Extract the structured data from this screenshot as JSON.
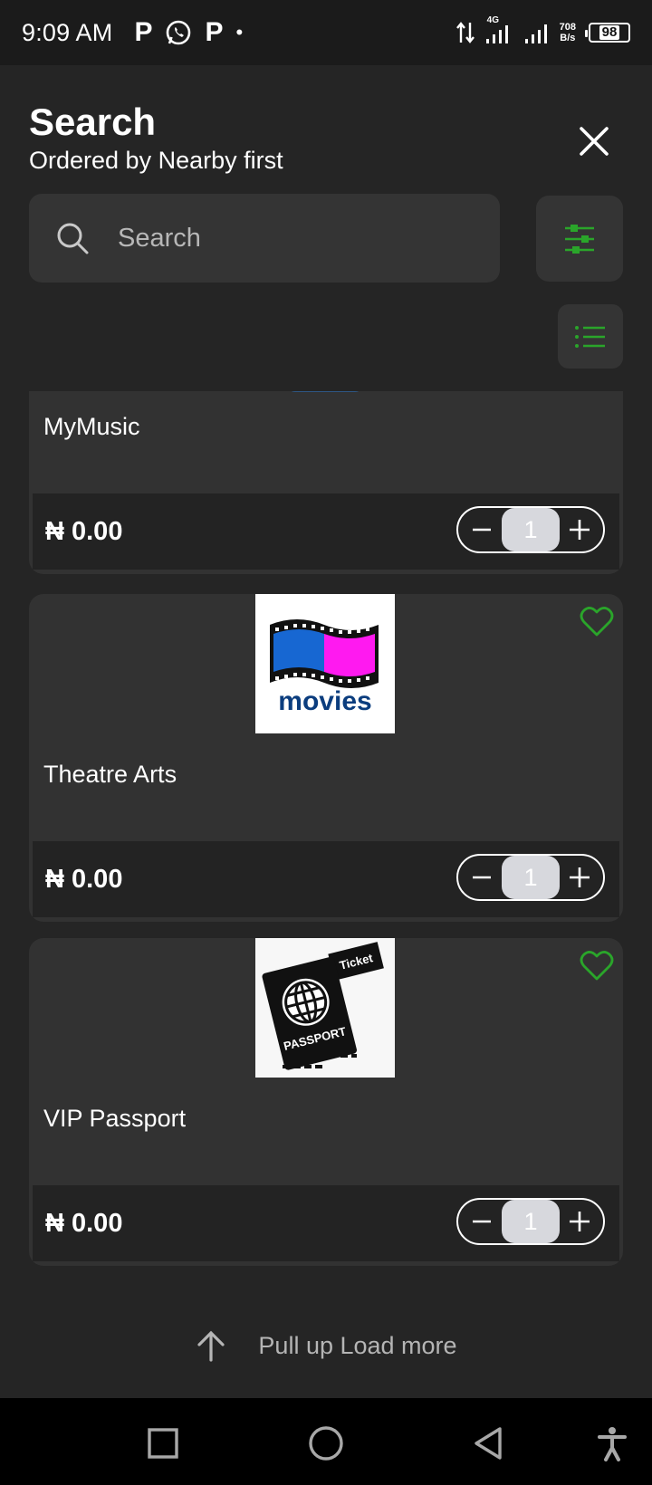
{
  "status_bar": {
    "time": "9:09 AM",
    "notif_p1": "P",
    "notif_p2": "P",
    "notif_dot": "•",
    "network_type": "4G",
    "net_speed_value": "708",
    "net_speed_unit": "B/s",
    "battery": "98"
  },
  "header": {
    "title": "Search",
    "subtitle": "Ordered by Nearby first"
  },
  "search": {
    "placeholder": "Search"
  },
  "products": [
    {
      "name": "MyMusic",
      "price": "₦ 0.00",
      "quantity": "1",
      "image": "music-app-icon"
    },
    {
      "name": "Theatre Arts",
      "price": "₦ 0.00",
      "quantity": "1",
      "image": "movies-film-strip-icon",
      "image_text": "movies",
      "favorite": false
    },
    {
      "name": "VIP Passport",
      "price": "₦ 0.00",
      "quantity": "1",
      "image": "passport-ticket-icon",
      "image_text": "PASSPORT",
      "image_text2": "Ticket",
      "favorite": false
    }
  ],
  "footer": {
    "load_more": "Pull up Load more"
  },
  "colors": {
    "accent_green": "#2aa52a",
    "background": "#252525",
    "card": "#323232"
  }
}
